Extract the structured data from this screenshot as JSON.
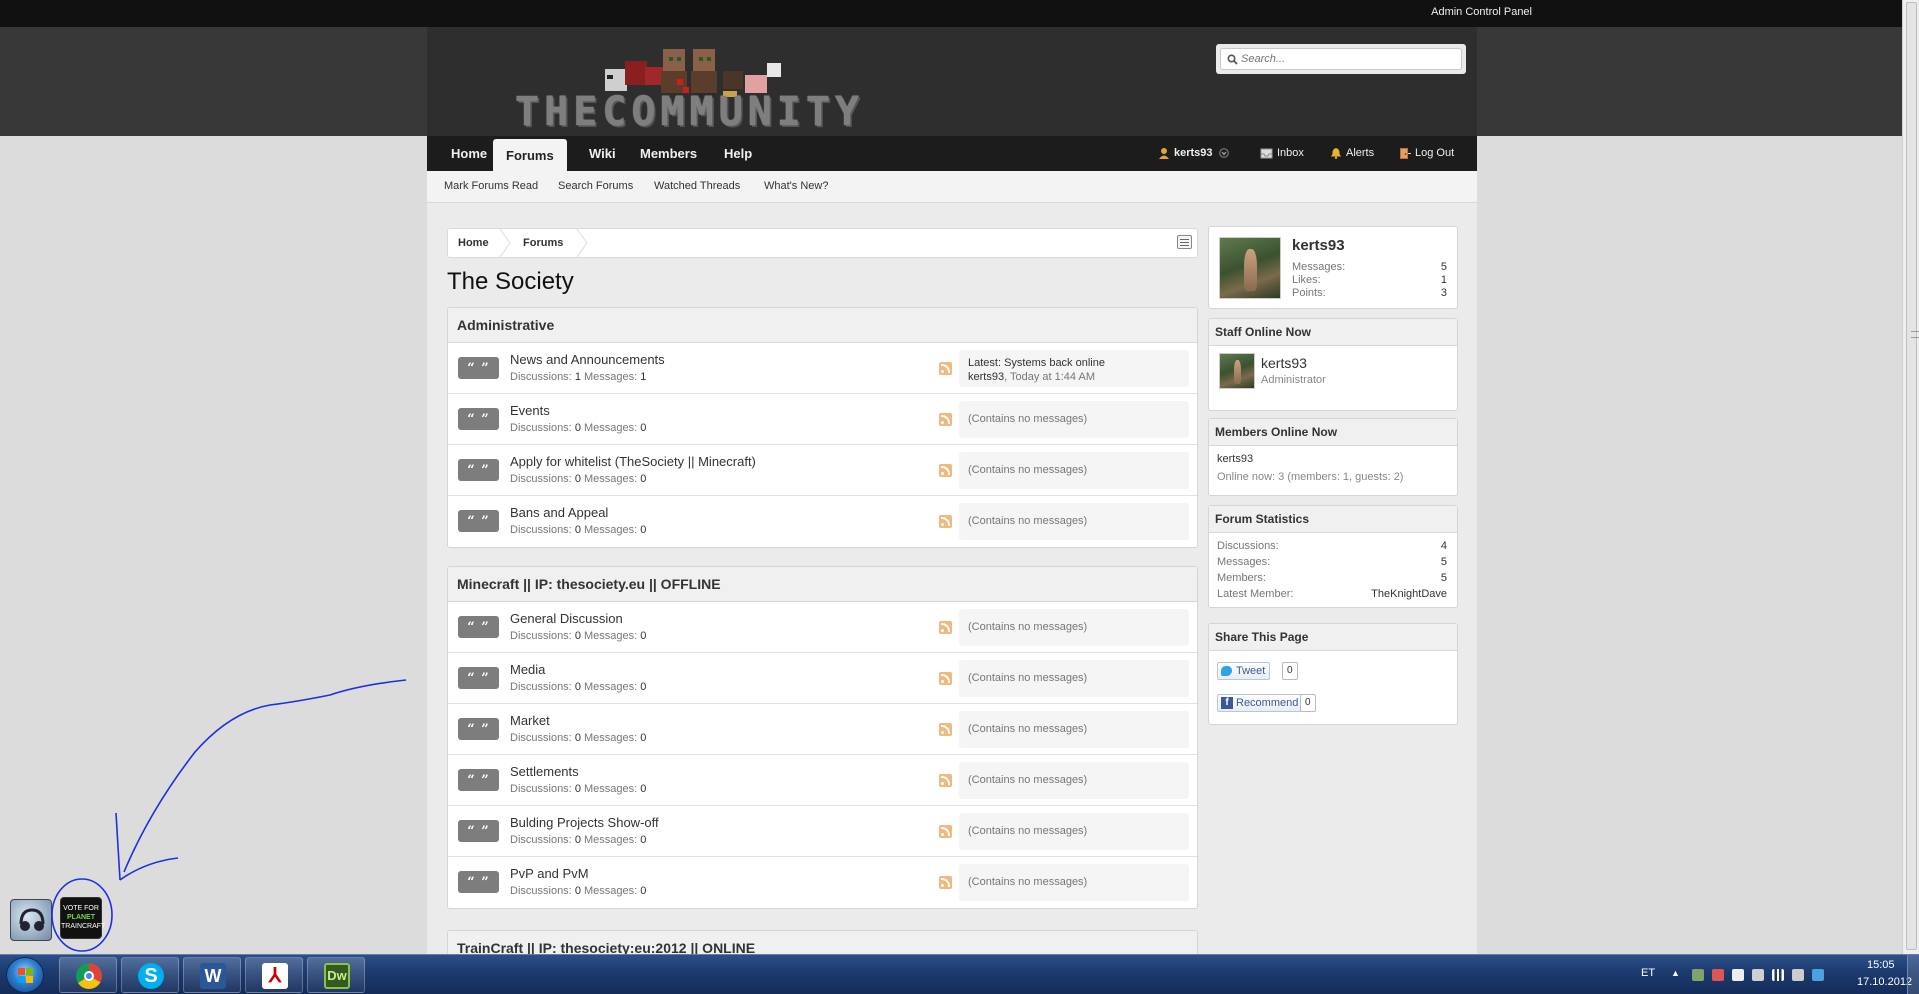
{
  "admin_bar": {
    "label": "Admin Control Panel"
  },
  "header": {
    "logo_text": "THECOMMUNITY",
    "search_placeholder": "Search..."
  },
  "nav": {
    "tabs": [
      {
        "label": "Home"
      },
      {
        "label": "Forums",
        "active": true
      },
      {
        "label": "Wiki"
      },
      {
        "label": "Members"
      },
      {
        "label": "Help"
      }
    ],
    "user": "kerts93",
    "inbox": "Inbox",
    "alerts": "Alerts",
    "logout": "Log Out"
  },
  "subnav": [
    "Mark Forums Read",
    "Search Forums",
    "Watched Threads",
    "What's New?"
  ],
  "breadcrumb": [
    "Home",
    "Forums"
  ],
  "page_title": "The Society",
  "categories": [
    {
      "title": "Administrative",
      "nodes": [
        {
          "title": "News and Announcements",
          "discussions": "1",
          "messages": "1",
          "latest_label": "Latest:",
          "latest_title": "Systems back online",
          "latest_user": "kerts93",
          "latest_time": ", Today at 1:44 AM"
        },
        {
          "title": "Events",
          "discussions": "0",
          "messages": "0",
          "empty": "(Contains no messages)"
        },
        {
          "title": "Apply for whitelist (TheSociety || Minecraft)",
          "discussions": "0",
          "messages": "0",
          "empty": "(Contains no messages)"
        },
        {
          "title": "Bans and Appeal",
          "discussions": "0",
          "messages": "0",
          "empty": "(Contains no messages)"
        }
      ]
    },
    {
      "title": "Minecraft || IP: thesociety.eu || OFFLINE",
      "nodes": [
        {
          "title": "General Discussion",
          "discussions": "0",
          "messages": "0",
          "empty": "(Contains no messages)"
        },
        {
          "title": "Media",
          "discussions": "0",
          "messages": "0",
          "empty": "(Contains no messages)"
        },
        {
          "title": "Market",
          "discussions": "0",
          "messages": "0",
          "empty": "(Contains no messages)"
        },
        {
          "title": "Settlements",
          "discussions": "0",
          "messages": "0",
          "empty": "(Contains no messages)"
        },
        {
          "title": "Bulding Projects Show-off",
          "discussions": "0",
          "messages": "0",
          "empty": "(Contains no messages)"
        },
        {
          "title": "PvP and PvM",
          "discussions": "0",
          "messages": "0",
          "empty": "(Contains no messages)"
        }
      ]
    },
    {
      "title": "TrainCraft || IP: thesociety:eu:2012 || ONLINE",
      "nodes": []
    }
  ],
  "labels": {
    "discussions": "Discussions:",
    "messages": "Messages:"
  },
  "sidebar": {
    "profile": {
      "name": "kerts93",
      "stats": [
        {
          "label": "Messages:",
          "value": "5"
        },
        {
          "label": "Likes:",
          "value": "1"
        },
        {
          "label": "Points:",
          "value": "3"
        }
      ]
    },
    "staff": {
      "title": "Staff Online Now",
      "name": "kerts93",
      "role": "Administrator"
    },
    "members_online": {
      "title": "Members Online Now",
      "name": "kerts93",
      "summary": "Online now: 3 (members: 1, guests: 2)"
    },
    "forum_stats": {
      "title": "Forum Statistics",
      "rows": [
        {
          "label": "Discussions:",
          "value": "4"
        },
        {
          "label": "Messages:",
          "value": "5"
        },
        {
          "label": "Members:",
          "value": "5"
        },
        {
          "label": "Latest Member:",
          "value": "TheKnightDave"
        }
      ]
    },
    "share": {
      "title": "Share This Page",
      "tweet": "Tweet",
      "tweet_count": "0",
      "recommend": "Recommend",
      "recommend_count": "0"
    }
  },
  "desktop": {
    "vote_lines": [
      "VOTE FOR",
      "PLANET",
      "TRAINCRAFT"
    ]
  },
  "taskbar": {
    "lang": "ET",
    "time": "15:05",
    "date": "17.10.2012"
  }
}
